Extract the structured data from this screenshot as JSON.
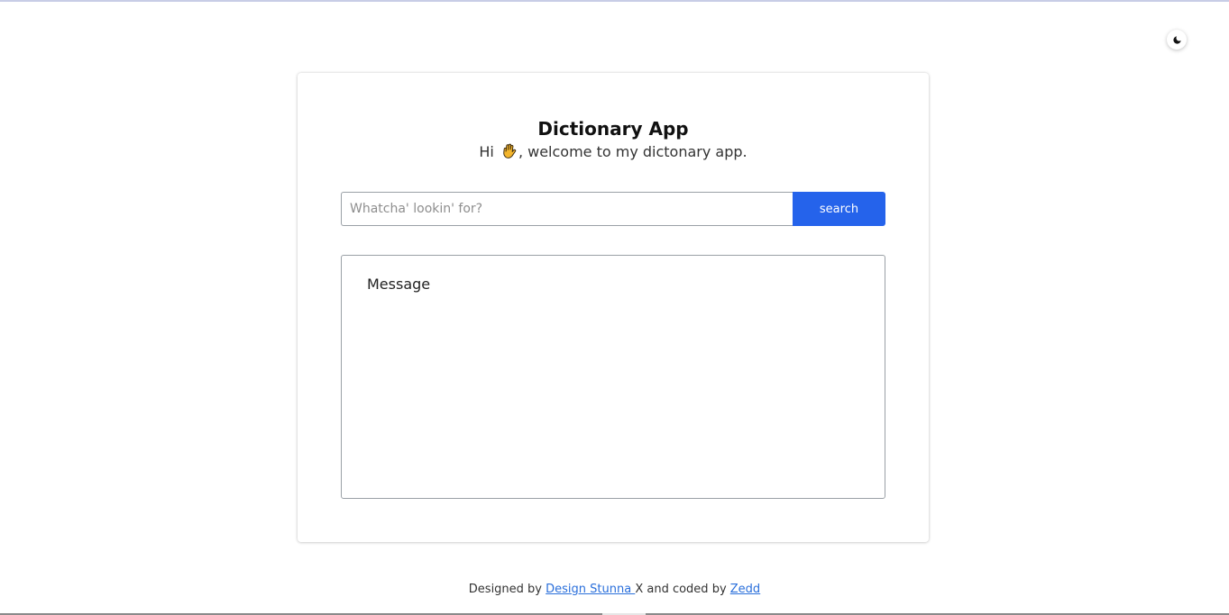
{
  "theme_toggle": {
    "icon": "moon-icon"
  },
  "card": {
    "title": "Dictionary App",
    "greeting_before": "Hi",
    "greeting_icon": "waving-hand-icon",
    "greeting_after": ", welcome to my dictonary app."
  },
  "search": {
    "placeholder": "Whatcha' lookin' for?",
    "value": "",
    "button_label": "search"
  },
  "message": {
    "text": "Message"
  },
  "footer": {
    "prefix": "Designed by",
    "designer_link": "Design Stunna ",
    "designer_suffix": "X",
    "middle": " and coded by",
    "coder_link": "Zedd"
  },
  "colors": {
    "accent": "#2563eb",
    "link": "#2a6fdb"
  }
}
